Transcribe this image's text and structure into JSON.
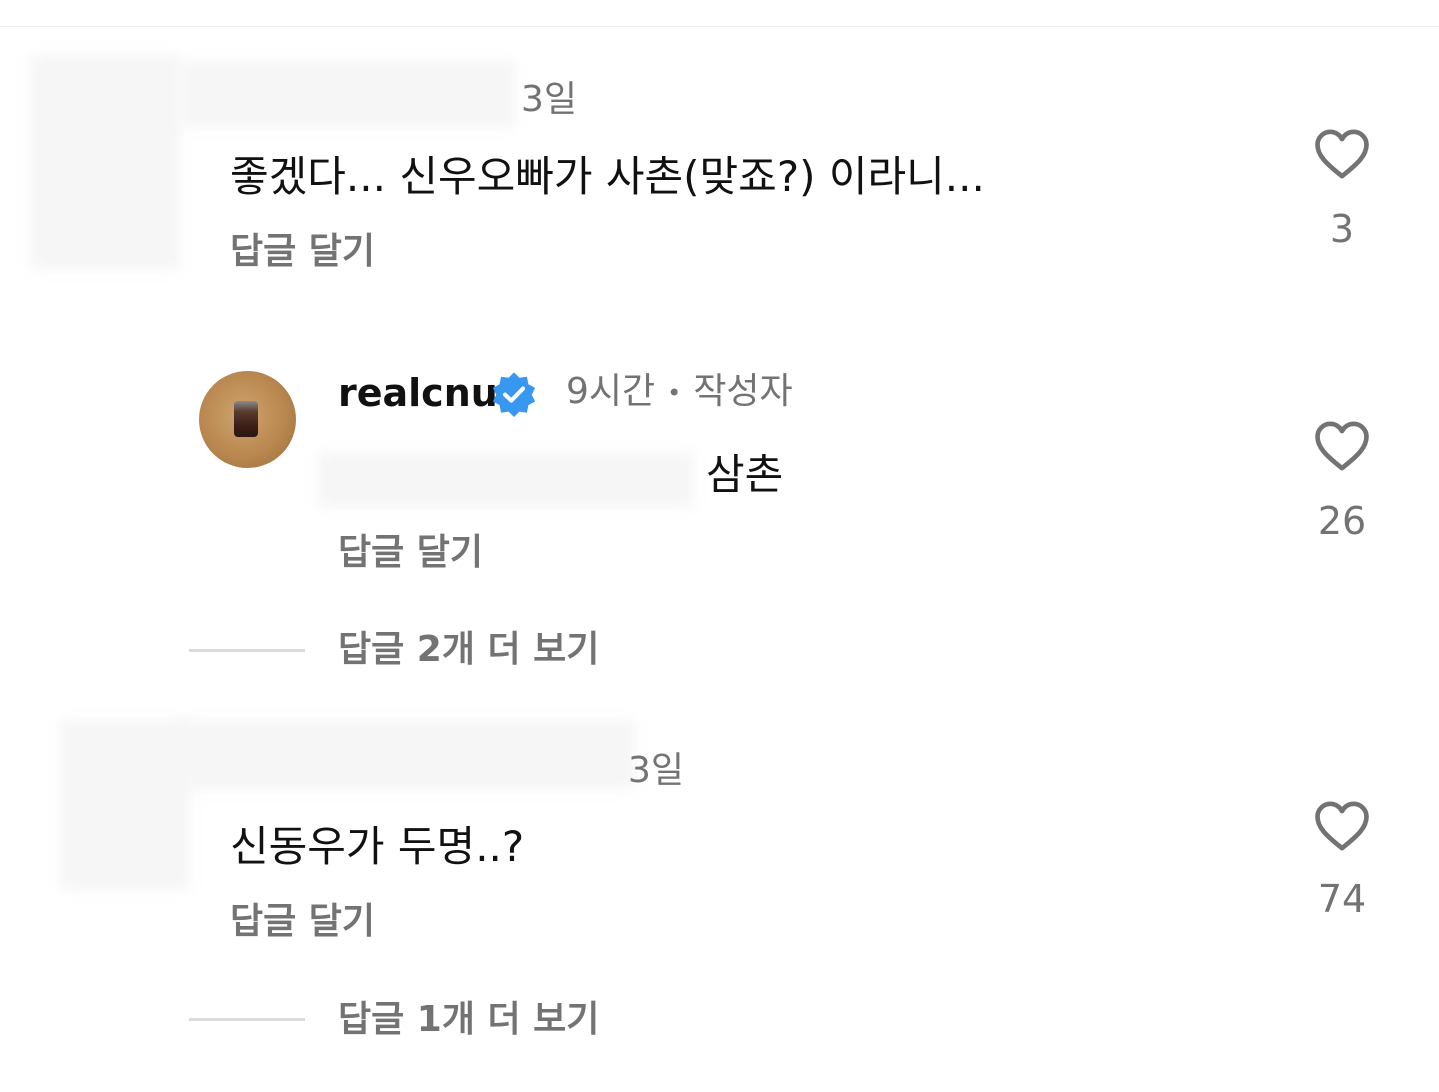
{
  "comments": [
    {
      "time": "3일",
      "text": "좋겠다... 신우오빠가 사촌(맞죠?) 이라니...",
      "reply_label": "답글 달기",
      "like_count": "3"
    },
    {
      "username": "realcnu",
      "time": "9시간",
      "author_badge": "작성자",
      "text": "삼촌",
      "reply_label": "답글 달기",
      "like_count": "26",
      "view_replies": "답글 2개 더 보기"
    },
    {
      "time": "3일",
      "text": "신동우가 두명..?",
      "reply_label": "답글 달기",
      "like_count": "74",
      "view_replies": "답글 1개 더 보기"
    }
  ],
  "colors": {
    "verified": "#3897f0",
    "secondary_text": "#737373",
    "primary_text": "#111111"
  },
  "icons": {
    "like": "heart-outline-icon",
    "verified": "verified-badge-icon"
  }
}
